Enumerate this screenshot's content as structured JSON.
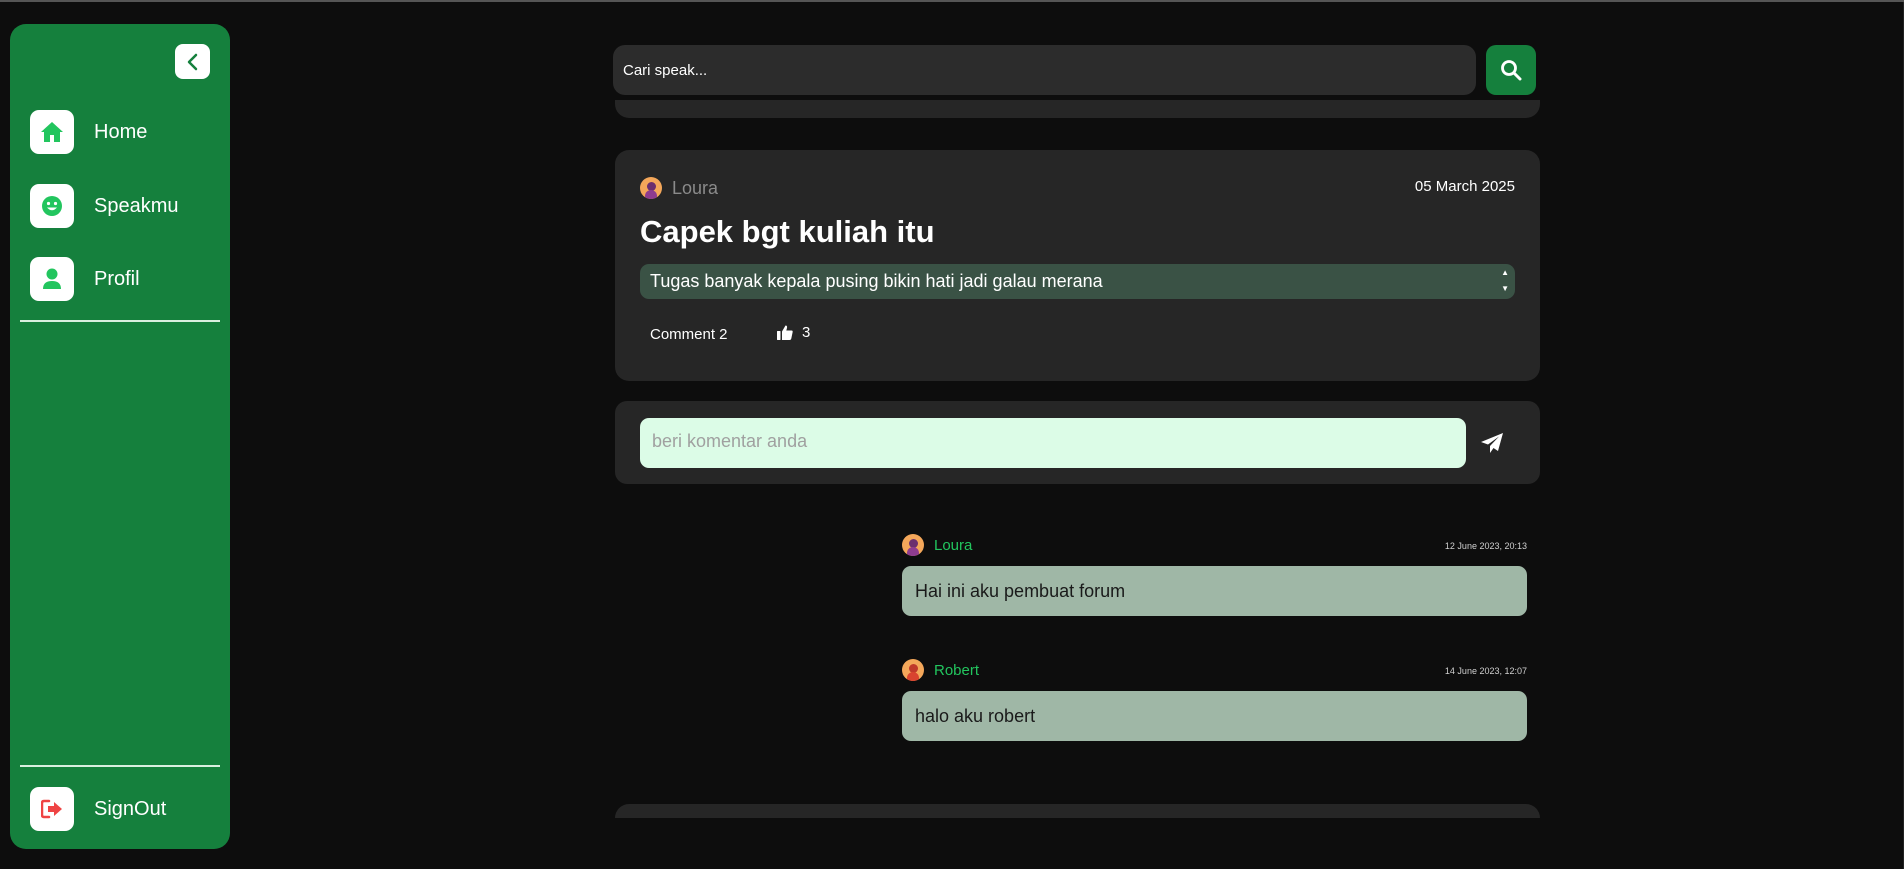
{
  "sidebar": {
    "items": [
      {
        "label": "Home",
        "icon": "home-icon"
      },
      {
        "label": "Speakmu",
        "icon": "smile-icon"
      },
      {
        "label": "Profil",
        "icon": "user-icon"
      }
    ],
    "signout_label": "SignOut",
    "colors": {
      "background": "#15803d",
      "icon": "#22c55e",
      "signout_icon": "#ef4444"
    }
  },
  "search": {
    "placeholder": "Cari speak..."
  },
  "post": {
    "author": "Loura",
    "date": "05 March 2025",
    "title": "Capek bgt kuliah itu",
    "body": "Tugas banyak kepala pusing bikin hati jadi galau merana",
    "comment_label": "Comment 2",
    "likes": "3"
  },
  "comment_form": {
    "placeholder": "beri komentar anda"
  },
  "comments": [
    {
      "author": "Loura",
      "time": "12 June 2023, 20:13",
      "text": "Hai ini aku pembuat forum"
    },
    {
      "author": "Robert",
      "time": "14 June 2023, 12:07",
      "text": "halo aku robert"
    }
  ]
}
